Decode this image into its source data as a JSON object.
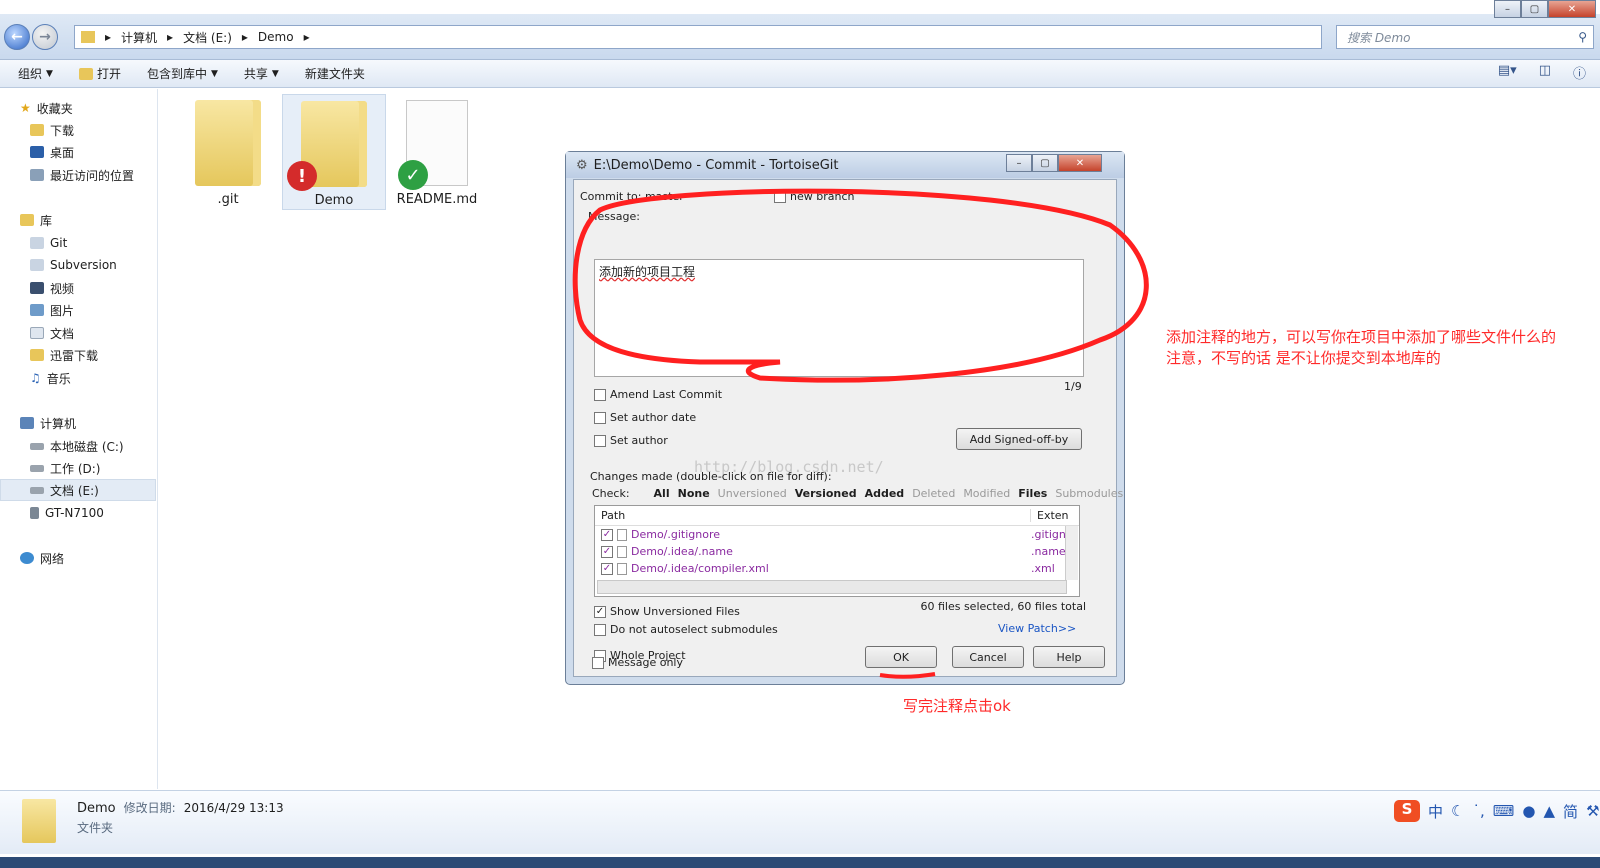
{
  "address": {
    "crumbs": [
      "计算机",
      "文档 (E:)",
      "Demo"
    ],
    "search_placeholder": "搜索 Demo"
  },
  "toolbar": {
    "organize": "组织",
    "open": "打开",
    "include": "包含到库中",
    "share": "共享",
    "new_folder": "新建文件夹"
  },
  "nav": {
    "favorites": "收藏夹",
    "downloads": "下载",
    "desktop": "桌面",
    "recent": "最近访问的位置",
    "libraries": "库",
    "git": "Git",
    "subversion": "Subversion",
    "videos": "视频",
    "pictures": "图片",
    "documents": "文档",
    "xunlei": "迅雷下载",
    "music": "音乐",
    "computer": "计算机",
    "drive_c": "本地磁盘 (C:)",
    "drive_d": "工作 (D:)",
    "drive_e": "文档 (E:)",
    "phone": "GT-N7100",
    "network": "网络"
  },
  "files": [
    ".git",
    "Demo",
    "README.md"
  ],
  "dialog": {
    "title": "E:\\Demo\\Demo - Commit - TortoiseGit",
    "commit_to": "Commit to:  master",
    "new_branch": "new branch",
    "message_label": "Message:",
    "message": "添加新的项目工程",
    "counter": "1/9",
    "amend": "Amend Last Commit",
    "author_date": "Set author date",
    "set_author": "Set author",
    "signed_off": "Add Signed-off-by",
    "changes_label": "Changes made (double-click on file for diff):",
    "check_label": "Check:",
    "filters": [
      "All",
      "None",
      "Unversioned",
      "Versioned",
      "Added",
      "Deleted",
      "Modified",
      "Files",
      "Submodules"
    ],
    "col_path": "Path",
    "col_ext": "Exten",
    "rows": [
      {
        "path": "Demo/.gitignore",
        "ext": ".gitign"
      },
      {
        "path": "Demo/.idea/.name",
        "ext": ".name"
      },
      {
        "path": "Demo/.idea/compiler.xml",
        "ext": ".xml"
      }
    ],
    "show_unversioned": "Show Unversioned Files",
    "no_autoselect": "Do not autoselect submodules",
    "selected_info": "60 files selected, 60 files total",
    "view_patch": "View Patch>>",
    "whole_project": "Whole Project",
    "message_only": "Message only",
    "ok": "OK",
    "cancel": "Cancel",
    "help": "Help"
  },
  "annotations": {
    "note1": "添加注释的地方，可以写你在项目中添加了哪些文件什么的",
    "note2": "注意，不写的话 是不让你提交到本地库的",
    "note3": "写完注释点击ok"
  },
  "watermark": "http://blog.csdn.net/",
  "details": {
    "name": "Demo",
    "modified_label": "修改日期:",
    "modified": "2016/4/29 13:13",
    "type": "文件夹"
  },
  "ime": {
    "lang": "中",
    "simplified": "简"
  }
}
